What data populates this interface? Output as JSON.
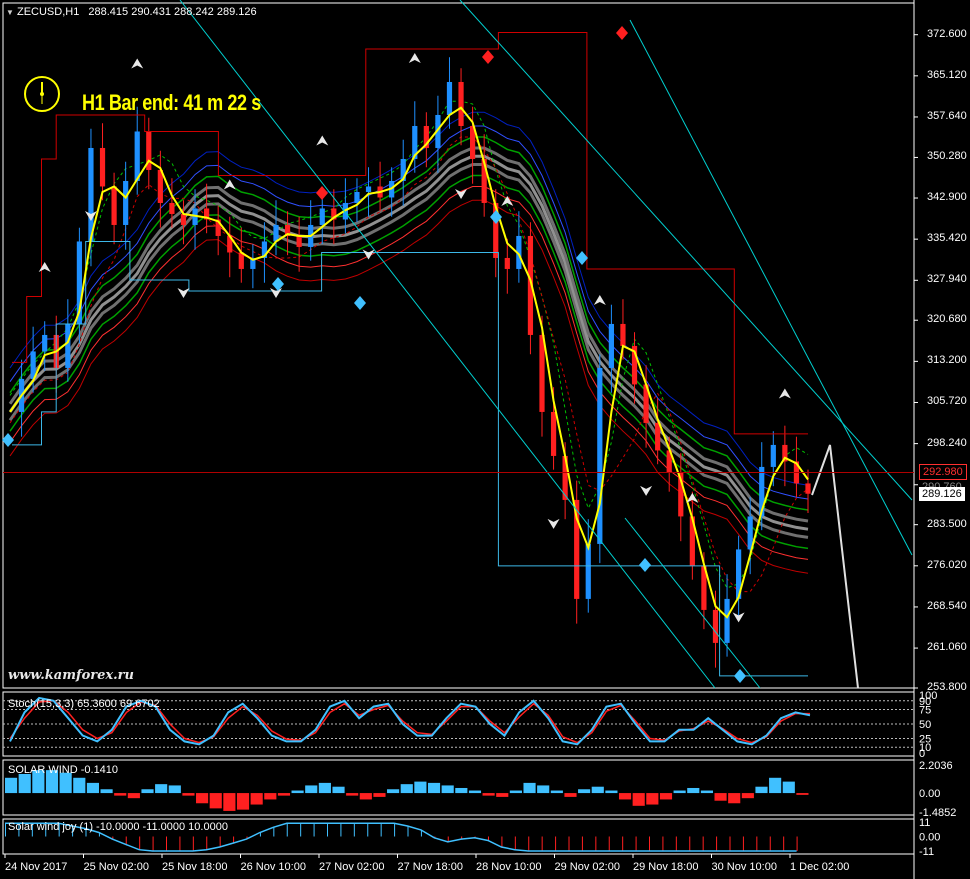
{
  "header": {
    "symbol": "ZECUSD,H1",
    "ohlc": "288.415 290.431 288.242 289.126"
  },
  "bar_end_label": "H1 Bar end: 41 m 22 s",
  "watermark": "www.kamforex.ru",
  "price_tags": {
    "red_level": "292.980",
    "current": "289.126",
    "hidden": "290.760"
  },
  "colors": {
    "bg": "#000000",
    "axis": "#ffffff",
    "bull": "#1e90ff",
    "bear": "#ff2020",
    "channel_red": "#d00000",
    "channel_cyan": "#3cb8e8",
    "trend": "#00d0d0",
    "yellow": "#ffff00",
    "hline": "#b00000"
  },
  "chart_data": [
    {
      "type": "line",
      "name": "price",
      "title": "ZECUSD,H1",
      "ylim": [
        253.8,
        376.0
      ],
      "y_ticks": [
        "372.600",
        "365.120",
        "357.640",
        "350.280",
        "342.900",
        "335.420",
        "327.940",
        "320.680",
        "313.200",
        "305.720",
        "298.240",
        "290.760",
        "283.500",
        "276.020",
        "268.540",
        "261.060",
        "253.800"
      ],
      "x_ticks": [
        "24 Nov 2017",
        "25 Nov 02:00",
        "25 Nov 18:00",
        "26 Nov 10:00",
        "27 Nov 02:00",
        "27 Nov 18:00",
        "28 Nov 10:00",
        "29 Nov 02:00",
        "29 Nov 18:00",
        "30 Nov 10:00",
        "1 Dec 02:00"
      ],
      "close": [
        304,
        310,
        315,
        318,
        312,
        320,
        335,
        352,
        345,
        338,
        346,
        355,
        348,
        342,
        340,
        338,
        341,
        339,
        336,
        333,
        330,
        332,
        335,
        338,
        336,
        334,
        338,
        341,
        339,
        342,
        344,
        345,
        343,
        346,
        350,
        356,
        352,
        358,
        364,
        356,
        350,
        342,
        332,
        330,
        336,
        318,
        304,
        296,
        288,
        270,
        280,
        312,
        320,
        316,
        309,
        302,
        297,
        293,
        285,
        276,
        268,
        262,
        270,
        279,
        285,
        294,
        298,
        295,
        291,
        289.126
      ],
      "upper_channel": [
        313,
        325,
        350,
        358,
        358,
        358,
        358,
        358,
        358,
        355,
        355,
        355,
        355,
        355,
        347,
        347,
        347,
        347,
        347,
        347,
        347,
        347,
        347,
        347,
        370,
        370,
        370,
        370,
        370,
        370,
        370,
        370,
        370,
        373,
        373,
        373,
        373,
        373,
        373,
        330,
        330,
        330,
        330,
        330,
        330,
        330,
        330,
        330,
        330,
        300,
        300,
        300,
        300,
        300
      ],
      "lower_channel": [
        298,
        298,
        304,
        320,
        320,
        335,
        335,
        335,
        328,
        328,
        328,
        328,
        326,
        326,
        326,
        326,
        326,
        326,
        326,
        326,
        326,
        333,
        333,
        333,
        333,
        333,
        333,
        333,
        333,
        333,
        333,
        333,
        333,
        276,
        276,
        276,
        276,
        276,
        276,
        276,
        276,
        276,
        276,
        276,
        276,
        276,
        276,
        276,
        256,
        256,
        256,
        256,
        256,
        256
      ],
      "horizontal_levels": [
        292.98
      ]
    },
    {
      "type": "line",
      "name": "stoch",
      "title": "Stoch(15,3,3) 65.3600 69.6702",
      "ylim": [
        0,
        100
      ],
      "y_ticks": [
        "100",
        "90",
        "75",
        "50",
        "25",
        "10",
        "0"
      ],
      "levels": [
        90,
        75,
        50,
        25,
        10
      ],
      "main": [
        20,
        70,
        95,
        90,
        60,
        30,
        20,
        40,
        80,
        90,
        80,
        40,
        20,
        15,
        30,
        70,
        85,
        60,
        30,
        20,
        20,
        40,
        80,
        90,
        60,
        80,
        85,
        50,
        30,
        30,
        60,
        85,
        80,
        50,
        30,
        70,
        90,
        60,
        20,
        15,
        40,
        80,
        85,
        50,
        20,
        20,
        40,
        40,
        60,
        40,
        20,
        15,
        30,
        60,
        70,
        65
      ],
      "signal": [
        25,
        60,
        88,
        90,
        70,
        40,
        25,
        35,
        70,
        88,
        82,
        50,
        25,
        18,
        28,
        60,
        80,
        65,
        38,
        24,
        22,
        35,
        70,
        85,
        65,
        75,
        82,
        55,
        35,
        32,
        55,
        80,
        80,
        55,
        35,
        62,
        85,
        65,
        28,
        18,
        35,
        72,
        82,
        55,
        25,
        22,
        38,
        42,
        55,
        42,
        25,
        18,
        28,
        55,
        68,
        68
      ]
    },
    {
      "type": "bar",
      "name": "solar_wind",
      "title": "SOLAR WIND -0.1410",
      "ylim": [
        -1.4852,
        2.2036
      ],
      "y_ticks": [
        "2.2036",
        "0.00",
        "-1.4852"
      ],
      "values": [
        1.2,
        1.5,
        1.8,
        1.8,
        1.6,
        1.2,
        0.8,
        0.3,
        -0.2,
        -0.4,
        0.3,
        0.7,
        0.6,
        -0.2,
        -0.8,
        -1.2,
        -1.4,
        -1.3,
        -0.9,
        -0.5,
        -0.2,
        0.2,
        0.6,
        0.8,
        0.5,
        -0.2,
        -0.5,
        -0.3,
        0.3,
        0.7,
        0.9,
        0.8,
        0.6,
        0.4,
        0.2,
        -0.2,
        -0.3,
        0.2,
        0.8,
        0.6,
        0.2,
        -0.3,
        0.3,
        0.5,
        0.2,
        -0.5,
        -1.0,
        -0.9,
        -0.5,
        0.2,
        0.4,
        0.2,
        -0.6,
        -0.8,
        -0.4,
        0.5,
        1.2,
        0.9,
        -0.14
      ]
    },
    {
      "type": "bar",
      "name": "solar_wind_joy",
      "title": "Solar wind joy (1) -10.0000 -11.0000 10.0000",
      "ylim": [
        -11,
        11
      ],
      "y_ticks": [
        "11",
        "0.00",
        "-11"
      ],
      "values": [
        10,
        10,
        10,
        10,
        10,
        8,
        6,
        3,
        -2,
        -6,
        -10,
        -11,
        -11,
        -11,
        -11,
        -10,
        -8,
        -5,
        -2,
        3,
        7,
        10,
        10,
        10,
        10,
        10,
        10,
        10,
        10,
        10,
        8,
        5,
        -1,
        -4,
        -2,
        -1,
        -3,
        -8,
        -10,
        -11,
        -11,
        -11,
        -11,
        -11,
        -11,
        -11,
        -11,
        -11,
        -11,
        -11,
        -11,
        -11,
        -11,
        -11,
        -11,
        -11,
        -11,
        -11,
        -11,
        -11
      ]
    }
  ]
}
